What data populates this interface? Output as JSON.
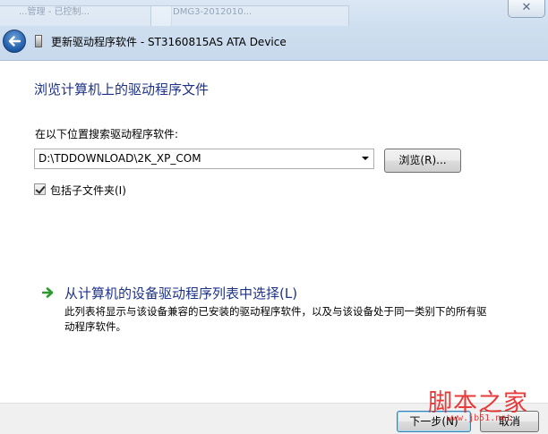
{
  "window": {
    "title": "更新驱动程序软件 - ST3160815AS ATA Device",
    "close_glyph": "✕",
    "background_pane_1": "...管理 - 已控制...",
    "background_pane_2": "DMG3-2012010..."
  },
  "main": {
    "heading": "浏览计算机上的驱动程序文件",
    "search_label": "在以下位置搜索驱动程序软件:",
    "path_value": "D:\\TDDOWNLOAD\\2K_XP_COM",
    "browse_label": "浏览(R)...",
    "include_subfolders_label": "包括子文件夹(I)",
    "include_subfolders_checked": true
  },
  "pick_option": {
    "link_text": "从计算机的设备驱动程序列表中选择(L)",
    "description": "此列表将显示与该设备兼容的已安装的驱动程序软件，以及与该设备处于同一类别下的所有驱动程序软件。"
  },
  "footer": {
    "next_label": "下一步(N)",
    "cancel_label": "取消"
  },
  "watermark": {
    "text": "脚本之家",
    "url": "www.jb51.net"
  },
  "colors": {
    "link_blue": "#1e3287",
    "watermark_red": "#e62b2b"
  }
}
